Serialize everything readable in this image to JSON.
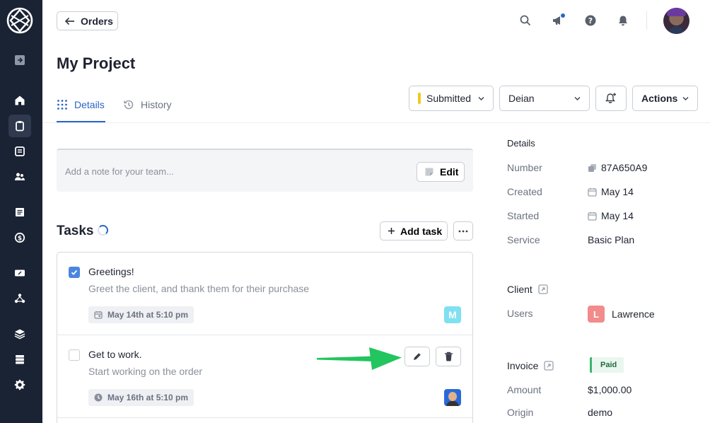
{
  "header": {
    "back_label": "Orders",
    "page_title": "My Project"
  },
  "tabs": [
    {
      "label": "Details",
      "active": true
    },
    {
      "label": "History",
      "active": false
    }
  ],
  "controls": {
    "status_label": "Submitted",
    "status_color": "#f2c81b",
    "assignee_label": "Deian",
    "actions_label": "Actions"
  },
  "note": {
    "placeholder": "Add a note for your team...",
    "edit_label": "Edit"
  },
  "tasks": {
    "title": "Tasks",
    "add_label": "Add task",
    "items": [
      {
        "title": "Greetings!",
        "description": "Greet the client, and thank them for their purchase",
        "date": "May 14th at 5:10 pm",
        "checked": true,
        "assignee_initial": "M"
      },
      {
        "title": "Get to work.",
        "description": "Start working on the order",
        "date": "May 16th at 5:10 pm",
        "checked": false
      }
    ]
  },
  "details": {
    "heading": "Details",
    "rows": [
      {
        "label": "Number",
        "value": "87A650A9"
      },
      {
        "label": "Created",
        "value": "May 14"
      },
      {
        "label": "Started",
        "value": "May 14"
      },
      {
        "label": "Service",
        "value": "Basic Plan"
      }
    ]
  },
  "client": {
    "heading": "Client",
    "users_label": "Users",
    "user_initial": "L",
    "user_name": "Lawrence"
  },
  "invoice": {
    "heading": "Invoice",
    "status": "Paid",
    "amount_label": "Amount",
    "amount_value": "$1,000.00",
    "origin_label": "Origin",
    "origin_value": "demo"
  },
  "colors": {
    "sidebar_bg": "#1a2334",
    "accent": "#2b66c4",
    "arrow": "#22c55e"
  }
}
